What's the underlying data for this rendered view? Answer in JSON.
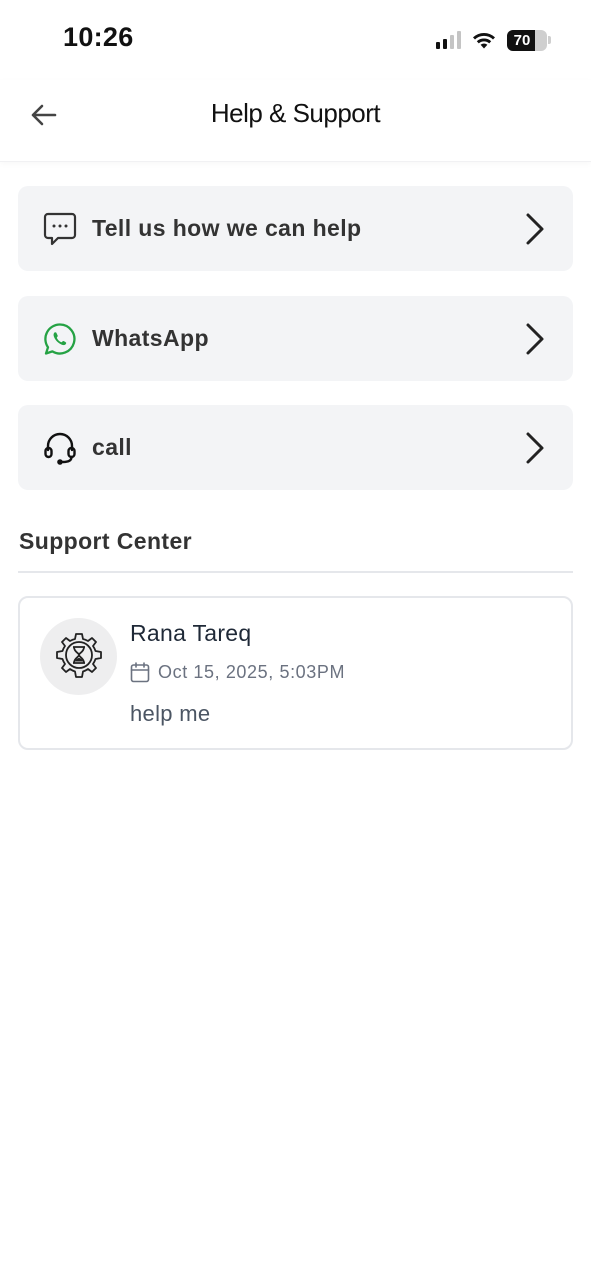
{
  "status_bar": {
    "time": "10:26",
    "battery_level": "70",
    "icons": [
      "cellular-signal-icon",
      "wifi-icon",
      "battery-icon"
    ]
  },
  "header": {
    "title": "Help & Support",
    "back_icon": "arrow-left-icon"
  },
  "menu": [
    {
      "label": "Tell us how we can help",
      "icon": "chat-bubble-icon"
    },
    {
      "label": "WhatsApp",
      "icon": "whatsapp-icon",
      "icon_color": "#25a244"
    },
    {
      "label": "call",
      "icon": "headset-icon"
    }
  ],
  "support_center": {
    "title": "Support Center",
    "tickets": [
      {
        "name": "Rana Tareq",
        "date": "Oct 15, 2025, 5:03PM",
        "message": "help me",
        "avatar_icon": "gear-hourglass-icon",
        "date_icon": "calendar-icon"
      }
    ]
  },
  "colors": {
    "card_bg": "#f3f4f6",
    "whatsapp_green": "#25a244",
    "text_primary": "#333333",
    "text_muted": "#6b7280"
  }
}
